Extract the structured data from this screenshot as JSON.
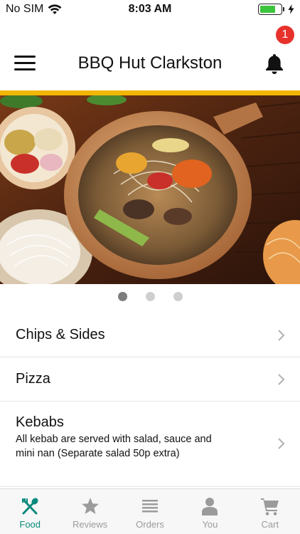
{
  "status_bar": {
    "carrier": "No SIM",
    "time": "8:03 AM",
    "battery_level": 0.75,
    "battery_color": "#3cc43c"
  },
  "header": {
    "title": "BBQ Hut Clarkston",
    "notification_count": "1",
    "accent_color": "#f2b705"
  },
  "carousel": {
    "slide_count": 3,
    "active_index": 0
  },
  "menu": {
    "items": [
      {
        "name": "Chips & Sides",
        "description": ""
      },
      {
        "name": "Pizza",
        "description": ""
      },
      {
        "name": "Kebabs",
        "description": "All kebab are served with salad, sauce and mini nan (Separate salad 50p extra)"
      }
    ]
  },
  "tabbar": {
    "active_color": "#0b8a7c",
    "inactive_color": "#9b9b9b",
    "tabs": [
      {
        "label": "Food",
        "icon": "fork-spoon-icon",
        "active": true
      },
      {
        "label": "Reviews",
        "icon": "star-icon",
        "active": false
      },
      {
        "label": "Orders",
        "icon": "list-icon",
        "active": false
      },
      {
        "label": "You",
        "icon": "person-icon",
        "active": false
      },
      {
        "label": "Cart",
        "icon": "cart-icon",
        "active": false
      }
    ]
  }
}
